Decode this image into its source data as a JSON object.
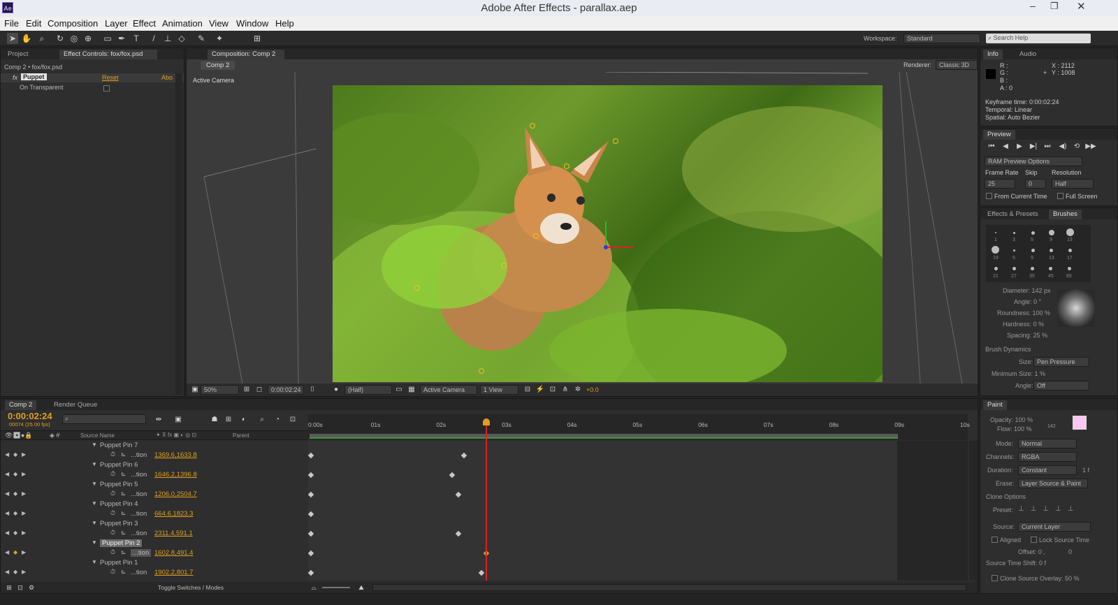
{
  "app": {
    "title": "Adobe After Effects - parallax.aep",
    "logo": "Ae"
  },
  "menu": [
    "File",
    "Edit",
    "Composition",
    "Layer",
    "Effect",
    "Animation",
    "View",
    "Window",
    "Help"
  ],
  "toolbar": {
    "workspace_label": "Workspace:",
    "workspace_value": "Standard",
    "search_placeholder": "Search Help"
  },
  "project_panel": {
    "tab_project": "Project",
    "tab_effect": "Effect Controls: fox/fox.psd",
    "breadcrumb": "Comp 2 • fox/fox.psd",
    "effect_name": "Puppet",
    "reset": "Reset",
    "about": "Abo",
    "on_transparent": "On Transparent",
    "fx": "fx"
  },
  "comp_panel": {
    "tab": "Composition: Comp 2",
    "subtab": "Comp 2",
    "renderer_label": "Renderer:",
    "renderer_value": "Classic 3D",
    "view_label": "Active Camera",
    "footer": {
      "zoom": "50%",
      "timecode": "0:00:02:24",
      "quality": "(Half)",
      "camera": "Active Camera",
      "views": "1 View",
      "exposure": "+0.0"
    }
  },
  "info_panel": {
    "tab_info": "Info",
    "tab_audio": "Audio",
    "r": "R :",
    "g": "G :",
    "b": "B :",
    "a": "A : 0",
    "x": "X : 2112",
    "y": "Y : 1008",
    "keyframe_time": "Keyframe time: 0:00:02:24",
    "temporal": "Temporal: Linear",
    "spatial": "Spatial: Auto Bezier"
  },
  "preview_panel": {
    "tab": "Preview",
    "ram_options": "RAM Preview Options",
    "frame_rate_label": "Frame Rate",
    "skip_label": "Skip",
    "resolution_label": "Resolution",
    "frame_rate": "25",
    "skip": "0",
    "resolution": "Half",
    "from_current": "From Current Time",
    "full_screen": "Full Screen"
  },
  "brushes_panel": {
    "tab_effects": "Effects & Presets",
    "tab_brushes": "Brushes",
    "brush_sizes": [
      "1",
      "3",
      "5",
      "9",
      "13",
      "19",
      "5",
      "9",
      "13",
      "17",
      "21",
      "27",
      "35",
      "45",
      "65"
    ],
    "diameter": "Diameter: 142 px",
    "angle": "Angle: 0 °",
    "roundness": "Roundness: 100 %",
    "hardness": "Hardness: 0 %",
    "spacing": "Spacing: 25 %",
    "dynamics": "Brush Dynamics",
    "size_label": "Size:",
    "size_value": "Pen Pressure",
    "min_size": "Minimum Size: 1 %",
    "angle_label": "Angle:",
    "angle_value": "Off"
  },
  "paint_panel": {
    "tab": "Paint",
    "opacity": "Opacity: 100 %",
    "flow": "Flow: 100 %",
    "flow_num": "142",
    "mode_label": "Mode:",
    "mode_value": "Normal",
    "channels_label": "Channels:",
    "channels_value": "RGBA",
    "duration_label": "Duration:",
    "duration_value": "Constant",
    "duration_extra": "1 f",
    "erase_label": "Erase:",
    "erase_value": "Layer Source & Paint",
    "clone_options": "Clone Options",
    "preset_label": "Preset:",
    "source_label": "Source:",
    "source_value": "Current Layer",
    "aligned": "Aligned",
    "lock_source": "Lock Source Time",
    "offset": "Offset: 0 ,",
    "offset_y": "0",
    "time_shift": "Source Time Shift: 0 f",
    "overlay": "Clone Source Overlay: 50 %"
  },
  "timeline": {
    "tab_comp": "Comp 2",
    "tab_render": "Render Queue",
    "timecode": "0:00:02:24",
    "frames": "00074 (25.00 fps)",
    "col_source": "Source Name",
    "col_parent": "Parent",
    "toggle": "Toggle Switches / Modes",
    "ruler": [
      "0:00s",
      "01s",
      "02s",
      "03s",
      "04s",
      "05s",
      "06s",
      "07s",
      "08s",
      "09s",
      "10s"
    ],
    "pins": [
      {
        "name": "Puppet Pin 7",
        "prop": "...tion",
        "value": "1369.6,1633.8",
        "kf": [
          0.0,
          0.26
        ]
      },
      {
        "name": "Puppet Pin 6",
        "prop": "...tion",
        "value": "1646.2,1396.8",
        "kf": [
          0.0,
          0.24
        ]
      },
      {
        "name": "Puppet Pin 5",
        "prop": "...tion",
        "value": "1206.0,2504.7",
        "kf": [
          0.0,
          0.25
        ]
      },
      {
        "name": "Puppet Pin 4",
        "prop": "...tion",
        "value": "664.6,1823.3",
        "kf": [
          0.0
        ]
      },
      {
        "name": "Puppet Pin 3",
        "prop": "...tion",
        "value": "2311.4,591.1",
        "kf": [
          0.0,
          0.25
        ]
      },
      {
        "name": "Puppet Pin 2",
        "prop": "...tion",
        "value": "1602.8,491.4",
        "kf": [
          0.0,
          0.298
        ]
      },
      {
        "name": "Puppet Pin 1",
        "prop": "...tion",
        "value": "1902.2,801.7",
        "kf": [
          0.0,
          0.29
        ]
      }
    ],
    "playhead": 0.298
  },
  "colors": {
    "accent": "#e0a020",
    "panel": "#2e2e2e",
    "bg": "#232323"
  },
  "icons": [
    "selection-tool-icon",
    "hand-tool-icon",
    "zoom-tool-icon",
    "rotate-tool-icon",
    "camera-tool-icon",
    "pan-behind-icon",
    "rectangle-tool-icon",
    "pen-tool-icon",
    "text-tool-icon",
    "brush-tool-icon",
    "clone-stamp-icon",
    "eraser-icon",
    "roto-brush-icon",
    "puppet-pin-icon"
  ]
}
